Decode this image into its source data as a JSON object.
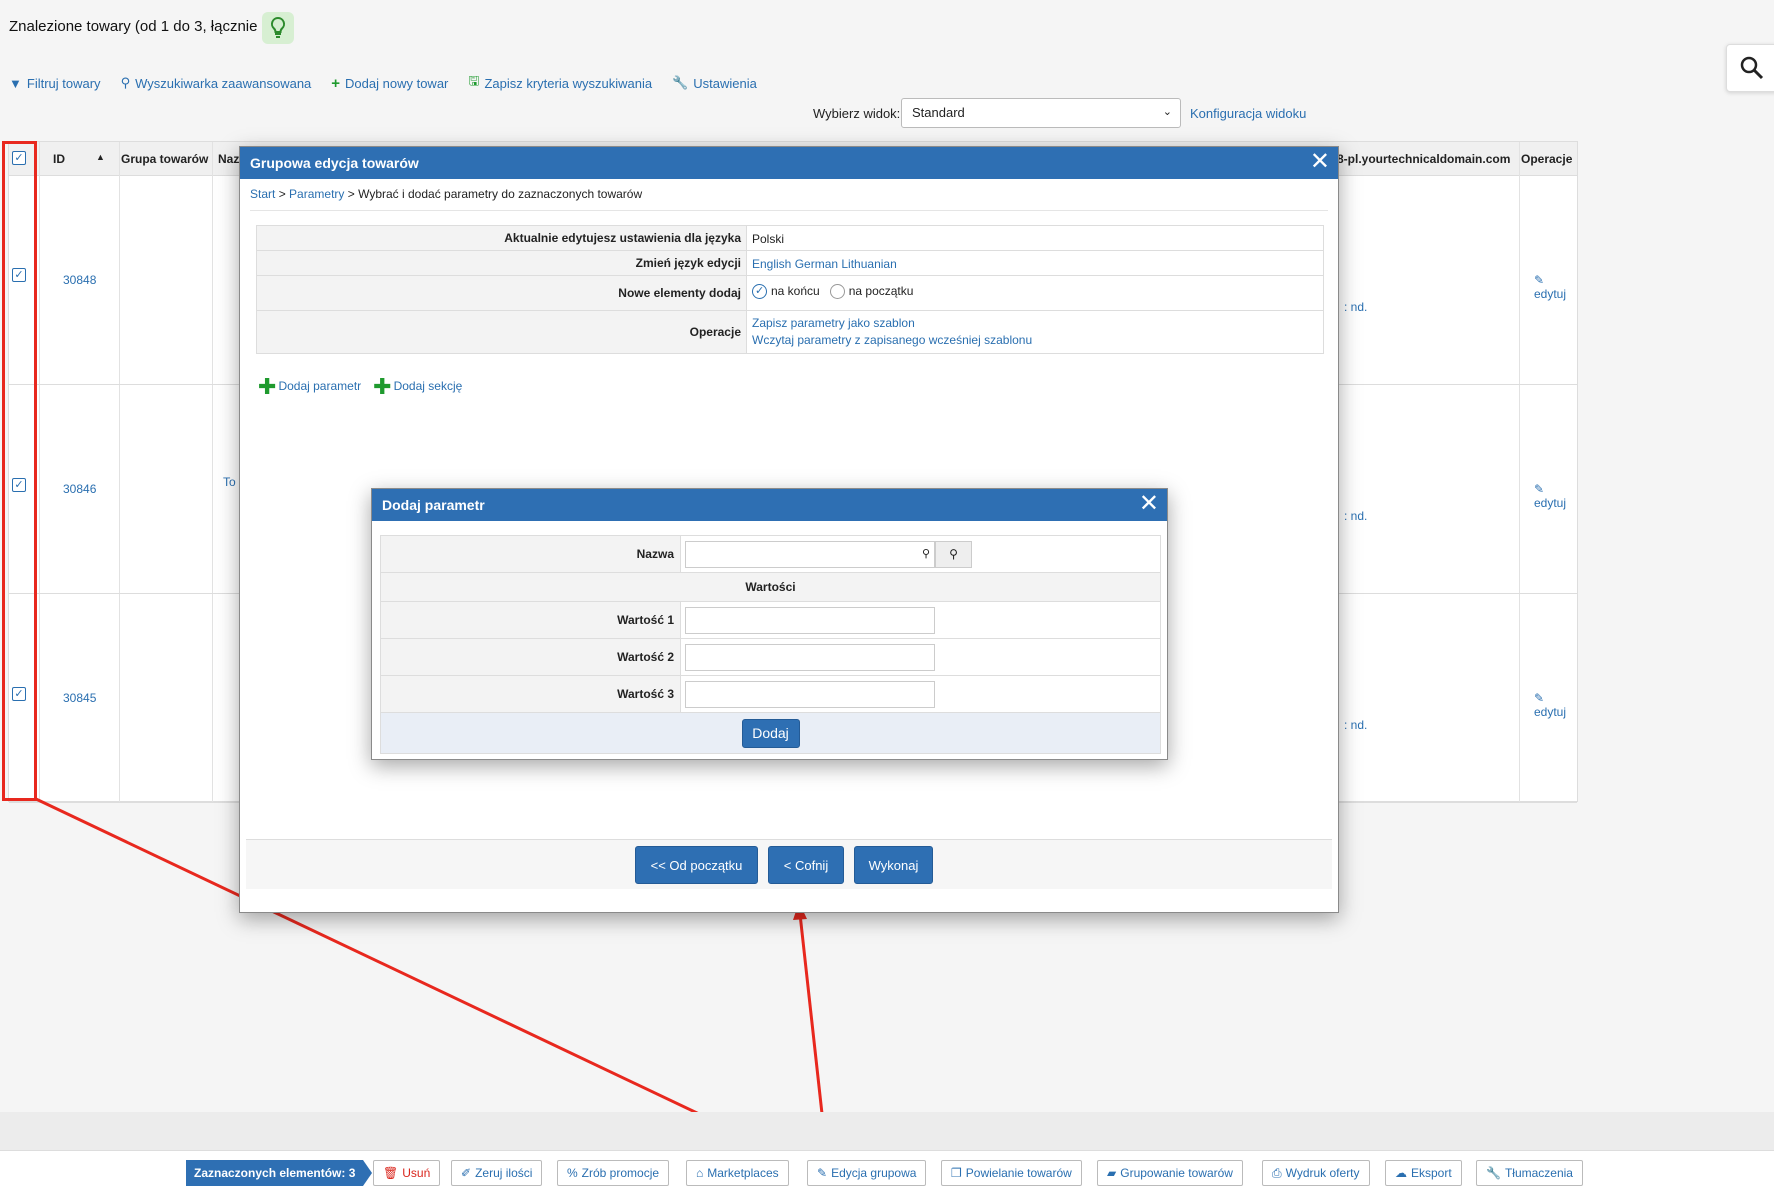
{
  "header": {
    "title": "Znalezione towary (od 1 do 3, łącznie 3)"
  },
  "toolbar": {
    "filter": "Filtruj towary",
    "advanced_search": "Wyszukiwarka zaawansowana",
    "add_product": "Dodaj nowy towar",
    "save_criteria": "Zapisz kryteria wyszukiwania",
    "settings": "Ustawienia"
  },
  "view": {
    "label": "Wybierz widok:",
    "selected": "Standard",
    "config_link": "Konfiguracja widoku"
  },
  "table": {
    "headers": {
      "id": "ID",
      "group": "Grupa towarów",
      "name": "Naz",
      "domain": "8-pl.yourtechnicaldomain.com",
      "operations": "Operacje"
    },
    "rows": [
      {
        "id": "30848",
        "nd": ": nd.",
        "edit": "edytuj"
      },
      {
        "id": "30846",
        "nd": ": nd.",
        "edit": "edytuj",
        "name_frag": "To"
      },
      {
        "id": "30845",
        "nd": ": nd.",
        "edit": "edytuj"
      }
    ]
  },
  "group_edit_modal": {
    "title": "Grupowa edycja towarów",
    "breadcrumb": {
      "start": "Start",
      "sep": ">",
      "params": "Parametry",
      "current": "Wybrać i dodać parametry do zaznaczonych towarów"
    },
    "settings": {
      "lang_label": "Aktualnie edytujesz ustawienia dla języka",
      "lang_value": "Polski",
      "change_lang_label": "Zmień język edycji",
      "langs": "English German Lithuanian",
      "new_items_label": "Nowe elementy dodaj",
      "option_end": "na końcu",
      "option_start": "na początku",
      "ops_label": "Operacje",
      "save_template": "Zapisz parametry jako szablon",
      "load_template": "Wczytaj parametry z zapisanego wcześniej szablonu"
    },
    "add_param": "Dodaj parametr",
    "add_section": "Dodaj sekcję",
    "buttons": {
      "from_start": "<< Od początku",
      "back": "< Cofnij",
      "execute": "Wykonaj"
    }
  },
  "add_param_modal": {
    "title": "Dodaj parametr",
    "name_label": "Nazwa",
    "values_header": "Wartości",
    "value1_label": "Wartość 1",
    "value2_label": "Wartość 2",
    "value3_label": "Wartość 3",
    "submit": "Dodaj"
  },
  "action_bar": {
    "selected": "Zaznaczonych elementów: 3",
    "delete": "Usuń",
    "zero_qty": "Zeruj ilości",
    "promo": "Zrób promocje",
    "marketplaces": "Marketplaces",
    "group_edit": "Edycja grupowa",
    "duplicate": "Powielanie towarów",
    "grouping": "Grupowanie towarów",
    "print_offer": "Wydruk oferty",
    "export": "Eksport",
    "translations": "Tłumaczenia"
  },
  "colors": {
    "accent": "#2e6fb3",
    "link": "#2a6fb0",
    "annotation": "#e8281e",
    "add_green": "#1f9a2e"
  }
}
